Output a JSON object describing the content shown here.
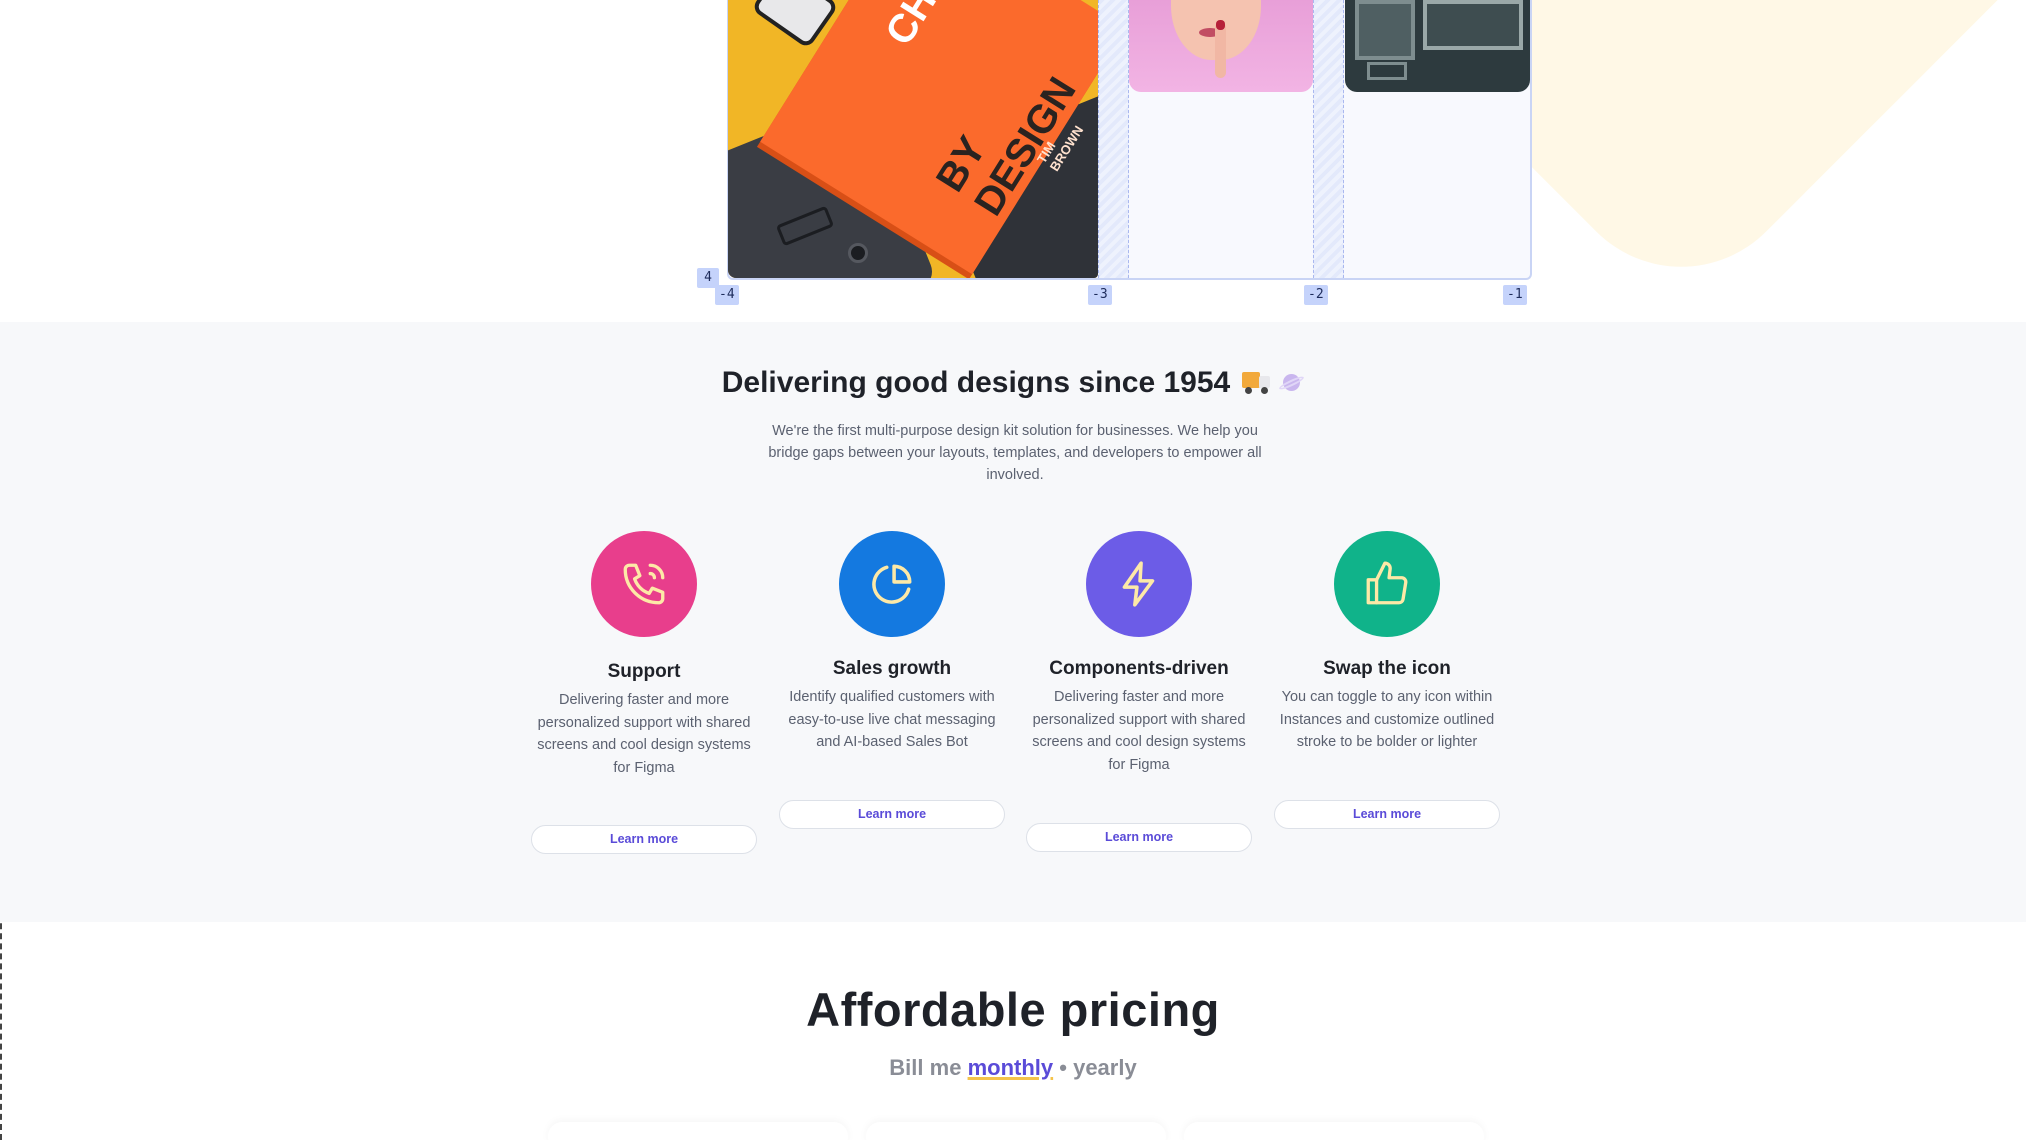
{
  "hero": {
    "grid_badges": [
      "4",
      "-4",
      "-3",
      "-2",
      "-1"
    ],
    "book": {
      "title_line1": "CHANG",
      "title_line2": "BY DESIGN",
      "author": "TIM BROWN"
    }
  },
  "features": {
    "title": "Delivering good designs since 1954",
    "description": "We're the first multi-purpose design kit solution for businesses. We help you bridge gaps between your layouts, templates, and developers to empower all involved.",
    "cards": [
      {
        "icon": "phone-call-icon",
        "color": "#e83e8c",
        "title": "Support",
        "description": "Delivering faster and more personalized support with shared screens and cool design systems for Figma",
        "button": "Learn more"
      },
      {
        "icon": "pie-chart-icon",
        "color": "#1479e0",
        "title": "Sales growth",
        "description": "Identify qualified customers with easy-to-use live chat messaging and AI-based Sales Bot",
        "button": "Learn more"
      },
      {
        "icon": "lightning-icon",
        "color": "#6c5ce7",
        "title": "Components-driven",
        "description": "Delivering faster and more personalized support with shared screens and cool design systems for Figma",
        "button": "Learn more"
      },
      {
        "icon": "thumbs-up-icon",
        "color": "#10b38a",
        "title": "Swap the icon",
        "description": "You can toggle to any icon within Instances and customize outlined stroke to be bolder or lighter",
        "button": "Learn more"
      }
    ],
    "icon_stroke_color": "#fde9a7"
  },
  "pricing": {
    "title": "Affordable pricing",
    "billing_prefix": "Bill me",
    "billing_active": "monthly",
    "billing_separator": "•",
    "billing_inactive": "yearly",
    "accent_color": "#5a4bd8"
  }
}
